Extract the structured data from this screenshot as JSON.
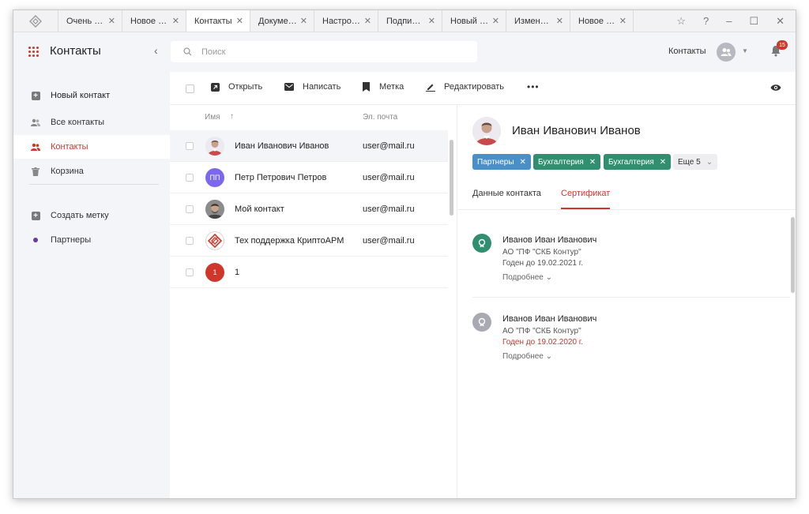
{
  "tabs": [
    {
      "label": "Очень ва…",
      "active": false
    },
    {
      "label": "Новое п…",
      "active": false
    },
    {
      "label": "Контакты",
      "active": true
    },
    {
      "label": "Докумен…",
      "active": false
    },
    {
      "label": "Настрой…",
      "active": false
    },
    {
      "label": "Подпись…",
      "active": false
    },
    {
      "label": "Новый ко…",
      "active": false
    },
    {
      "label": "Изменит…",
      "active": false
    },
    {
      "label": "Новое п…",
      "active": false
    }
  ],
  "header": {
    "title": "Контакты",
    "search_placeholder": "Поиск",
    "account_label": "Контакты",
    "notifications_count": "15"
  },
  "sidebar": {
    "new_contact": "Новый контакт",
    "items": [
      {
        "label": "Все контакты",
        "icon": "people-icon"
      },
      {
        "label": "Контакты",
        "icon": "people-icon",
        "active": true
      },
      {
        "label": "Корзина",
        "icon": "trash-icon"
      }
    ],
    "create_tag": "Создать метку",
    "tags": [
      {
        "label": "Партнеры",
        "color": "#6a3aa8"
      }
    ]
  },
  "toolbar": {
    "open": "Открыть",
    "write": "Написать",
    "tag": "Метка",
    "edit": "Редактировать",
    "more": "•••"
  },
  "list": {
    "col_name": "Имя",
    "col_email": "Эл. почта",
    "rows": [
      {
        "name": "Иван Иванович Иванов",
        "email": "user@mail.ru",
        "avatar_type": "photo",
        "selected": true
      },
      {
        "name": "Петр Петрович Петров",
        "email": "user@mail.ru",
        "avatar_type": "initials",
        "initials": "ПП",
        "avatar_color": "#7b68ee"
      },
      {
        "name": "Мой контакт",
        "email": "user@mail.ru",
        "avatar_type": "photo"
      },
      {
        "name": "Тех поддержка КриптоАРМ",
        "email": "user@mail.ru",
        "avatar_type": "logo"
      },
      {
        "name": "1",
        "email": "",
        "avatar_type": "initials",
        "initials": "1",
        "avatar_color": "#d0372b"
      }
    ]
  },
  "detail": {
    "name": "Иван Иванович Иванов",
    "tags": [
      {
        "label": "Партнеры",
        "color": "#4a90c8"
      },
      {
        "label": "Бухгалтерия",
        "color": "#2f8f6f"
      },
      {
        "label": "Бухгалтерия",
        "color": "#2f8f6f"
      }
    ],
    "more_tags": "Еще 5",
    "tab_data": "Данные контакта",
    "tab_cert": "Сертификат",
    "certificates": [
      {
        "name": "Иванов Иван Иванович",
        "org": "АО \"ПФ \"СКБ Контур\"",
        "valid": "Годен до 19.02.2021 г.",
        "expired": false,
        "more": "Подробнее",
        "color": "#2f8f6f"
      },
      {
        "name": "Иванов Иван Иванович",
        "org": "АО \"ПФ \"СКБ Контур\"",
        "valid": "Годен до 19.02.2020 г.",
        "expired": true,
        "more": "Подробнее",
        "color": "#a9a9b3"
      }
    ]
  },
  "colors": {
    "accent": "#d0372b",
    "sidebar_bg": "#f4f5f9",
    "tag_blue": "#4a90c8",
    "tag_green": "#2f8f6f"
  }
}
